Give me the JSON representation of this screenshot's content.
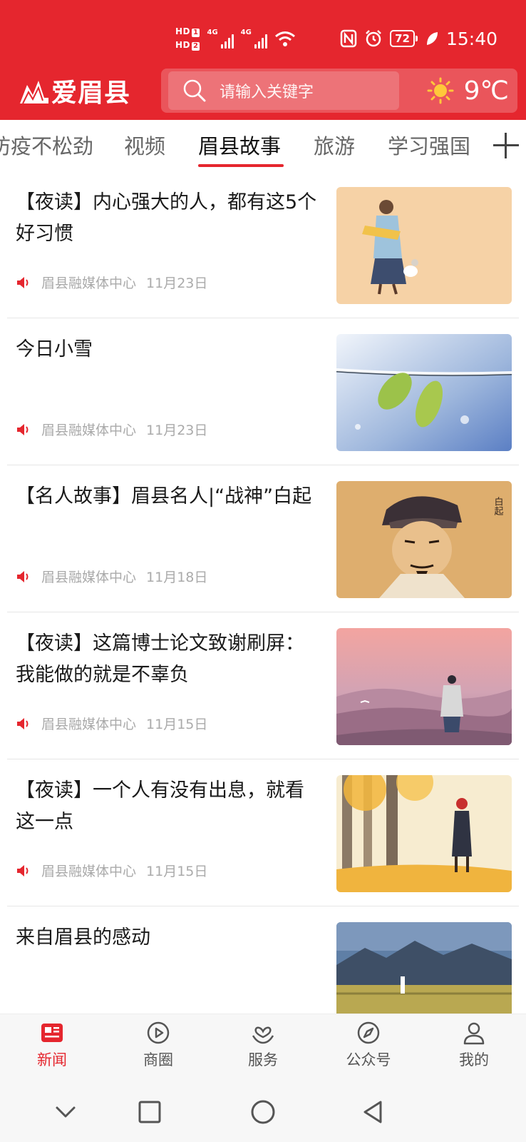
{
  "status_bar": {
    "hd1": "HD",
    "hd1_sub": "1",
    "hd2": "HD",
    "hd2_sub": "2",
    "net1": "4G",
    "net2": "4G",
    "battery": "72",
    "time": "15:40"
  },
  "app": {
    "logo_text": "爱眉县",
    "search_placeholder": "请输入关键字",
    "temperature": "9℃"
  },
  "tabs": [
    {
      "label": "防疫不松劲"
    },
    {
      "label": "视频"
    },
    {
      "label": "眉县故事",
      "active": true
    },
    {
      "label": "旅游"
    },
    {
      "label": "学习强国"
    }
  ],
  "news": [
    {
      "title": "【夜读】内心强大的人，都有这5个好习惯",
      "source": "眉县融媒体中心",
      "date": "11月23日"
    },
    {
      "title": "今日小雪",
      "source": "眉县融媒体中心",
      "date": "11月23日"
    },
    {
      "title": "【名人故事】眉县名人|“战神”白起",
      "source": "眉县融媒体中心",
      "date": "11月18日"
    },
    {
      "title": "【夜读】这篇博士论文致谢刷屏：我能做的就是不辜负",
      "source": "眉县融媒体中心",
      "date": "11月15日"
    },
    {
      "title": "【夜读】一个人有没有出息，就看这一点",
      "source": "眉县融媒体中心",
      "date": "11月15日"
    },
    {
      "title": "来自眉县的感动",
      "source": "",
      "date": ""
    }
  ],
  "thumb_texts": {
    "portrait_caption": "白起"
  },
  "bottom_nav": [
    {
      "label": "新闻",
      "icon": "news-icon",
      "active": true
    },
    {
      "label": "商圈",
      "icon": "play-circle-icon"
    },
    {
      "label": "服务",
      "icon": "service-heart-icon"
    },
    {
      "label": "公众号",
      "icon": "compass-icon"
    },
    {
      "label": "我的",
      "icon": "user-icon"
    }
  ],
  "colors": {
    "brand_red": "#e5262e",
    "meta_gray": "#aaaaaa"
  }
}
